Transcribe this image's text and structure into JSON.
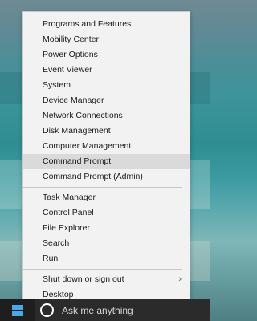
{
  "menu": {
    "items_group1": [
      {
        "label": "Programs and Features"
      },
      {
        "label": "Mobility Center"
      },
      {
        "label": "Power Options"
      },
      {
        "label": "Event Viewer"
      },
      {
        "label": "System"
      },
      {
        "label": "Device Manager"
      },
      {
        "label": "Network Connections"
      },
      {
        "label": "Disk Management"
      },
      {
        "label": "Computer Management"
      },
      {
        "label": "Command Prompt"
      },
      {
        "label": "Command Prompt (Admin)"
      }
    ],
    "items_group2": [
      {
        "label": "Task Manager"
      },
      {
        "label": "Control Panel"
      },
      {
        "label": "File Explorer"
      },
      {
        "label": "Search"
      },
      {
        "label": "Run"
      }
    ],
    "items_group3": [
      {
        "label": "Shut down or sign out",
        "submenu_icon": "chevron-right-icon"
      },
      {
        "label": "Desktop"
      }
    ],
    "highlighted_item": "Command Prompt"
  },
  "taskbar": {
    "start_icon": "windows-logo-icon",
    "search_placeholder": "Ask me anything",
    "cortana_icon": "cortana-circle-icon",
    "colors": {
      "background": "#1e1e1e",
      "search": "#2b2b2b",
      "logo": "#4aa8e8"
    }
  }
}
